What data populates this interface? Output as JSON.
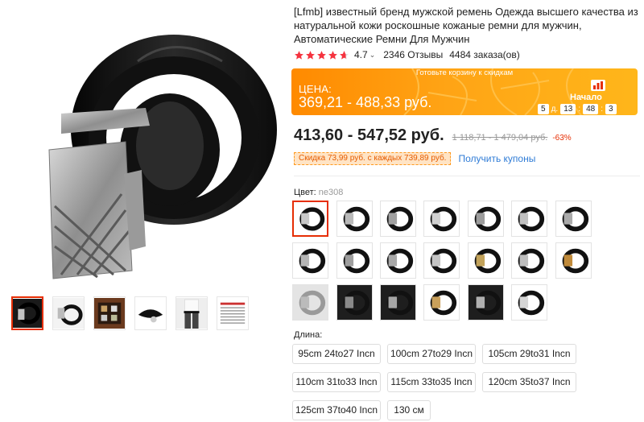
{
  "product": {
    "title": "[Lfmb] известный бренд мужской ремень Одежда высшего качества из натуральной кожи роскошные кожаные ремни для мужчин, Автоматические Ремни Для Мужчин",
    "rating": "4.7",
    "reviews": "2346 Отзывы",
    "orders": "4484 заказа(ов)"
  },
  "promo": {
    "header": "Готовьте корзину к скидкам",
    "price_label": "ЦЕНА:",
    "price": "369,21 - 488,33 руб.",
    "start_label": "Начало",
    "timer": {
      "days": "5",
      "days_unit": "д.",
      "hours": "13",
      "minutes": "48",
      "seconds": "3"
    }
  },
  "pricing": {
    "price": "413,60 - 547,52 руб.",
    "old_price": "1 118,71 - 1 479,04 руб.",
    "discount": "-63%"
  },
  "coupon": {
    "tag": "Скидка 73,99 руб. с каждых 739,89 руб.",
    "link": "Получить купоны"
  },
  "color": {
    "label": "Цвет:",
    "selected": "ne308"
  },
  "length": {
    "label": "Длина:",
    "options": [
      "95cm 24to27 Incn",
      "100cm 27to29 Incn",
      "105cm 29to31 Incn",
      "110cm 31to33 Incn",
      "115cm 33to35 Incn",
      "120cm 35to37 Incn",
      "125cm 37to40 Incn",
      "130 см"
    ]
  },
  "colors": {
    "accent": "#e62e04",
    "star": "#f5333f",
    "link": "#2e7bd6",
    "promo": "#ff9a00"
  }
}
